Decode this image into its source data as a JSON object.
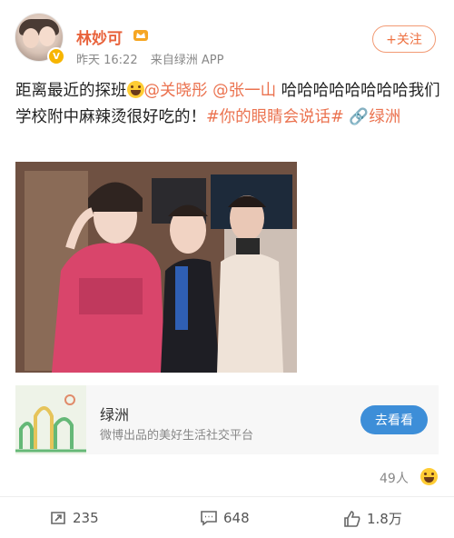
{
  "post": {
    "username": "林妙可",
    "time": "昨天 16:22",
    "source": "来自绿洲 APP",
    "follow_label": "+关注",
    "text_part1": "距离最近的探班",
    "mention1": "@关晓彤",
    "mention2": "@张一山",
    "text_part2": " 哈哈哈哈哈哈哈哈我们学校附中麻辣烫很好吃的！",
    "hashtag": "#你的眼睛会说话#",
    "link_label": "绿洲"
  },
  "card": {
    "title": "绿洲",
    "subtitle": "微博出品的美好生活社交平台",
    "button_label": "去看看"
  },
  "reactions": {
    "count_label": "49人"
  },
  "actions": {
    "repost": "235",
    "comment": "648",
    "like": "1.8万"
  },
  "colors": {
    "accent": "#eb7350",
    "button": "#3d8ed8",
    "badge": "#f7b500"
  }
}
